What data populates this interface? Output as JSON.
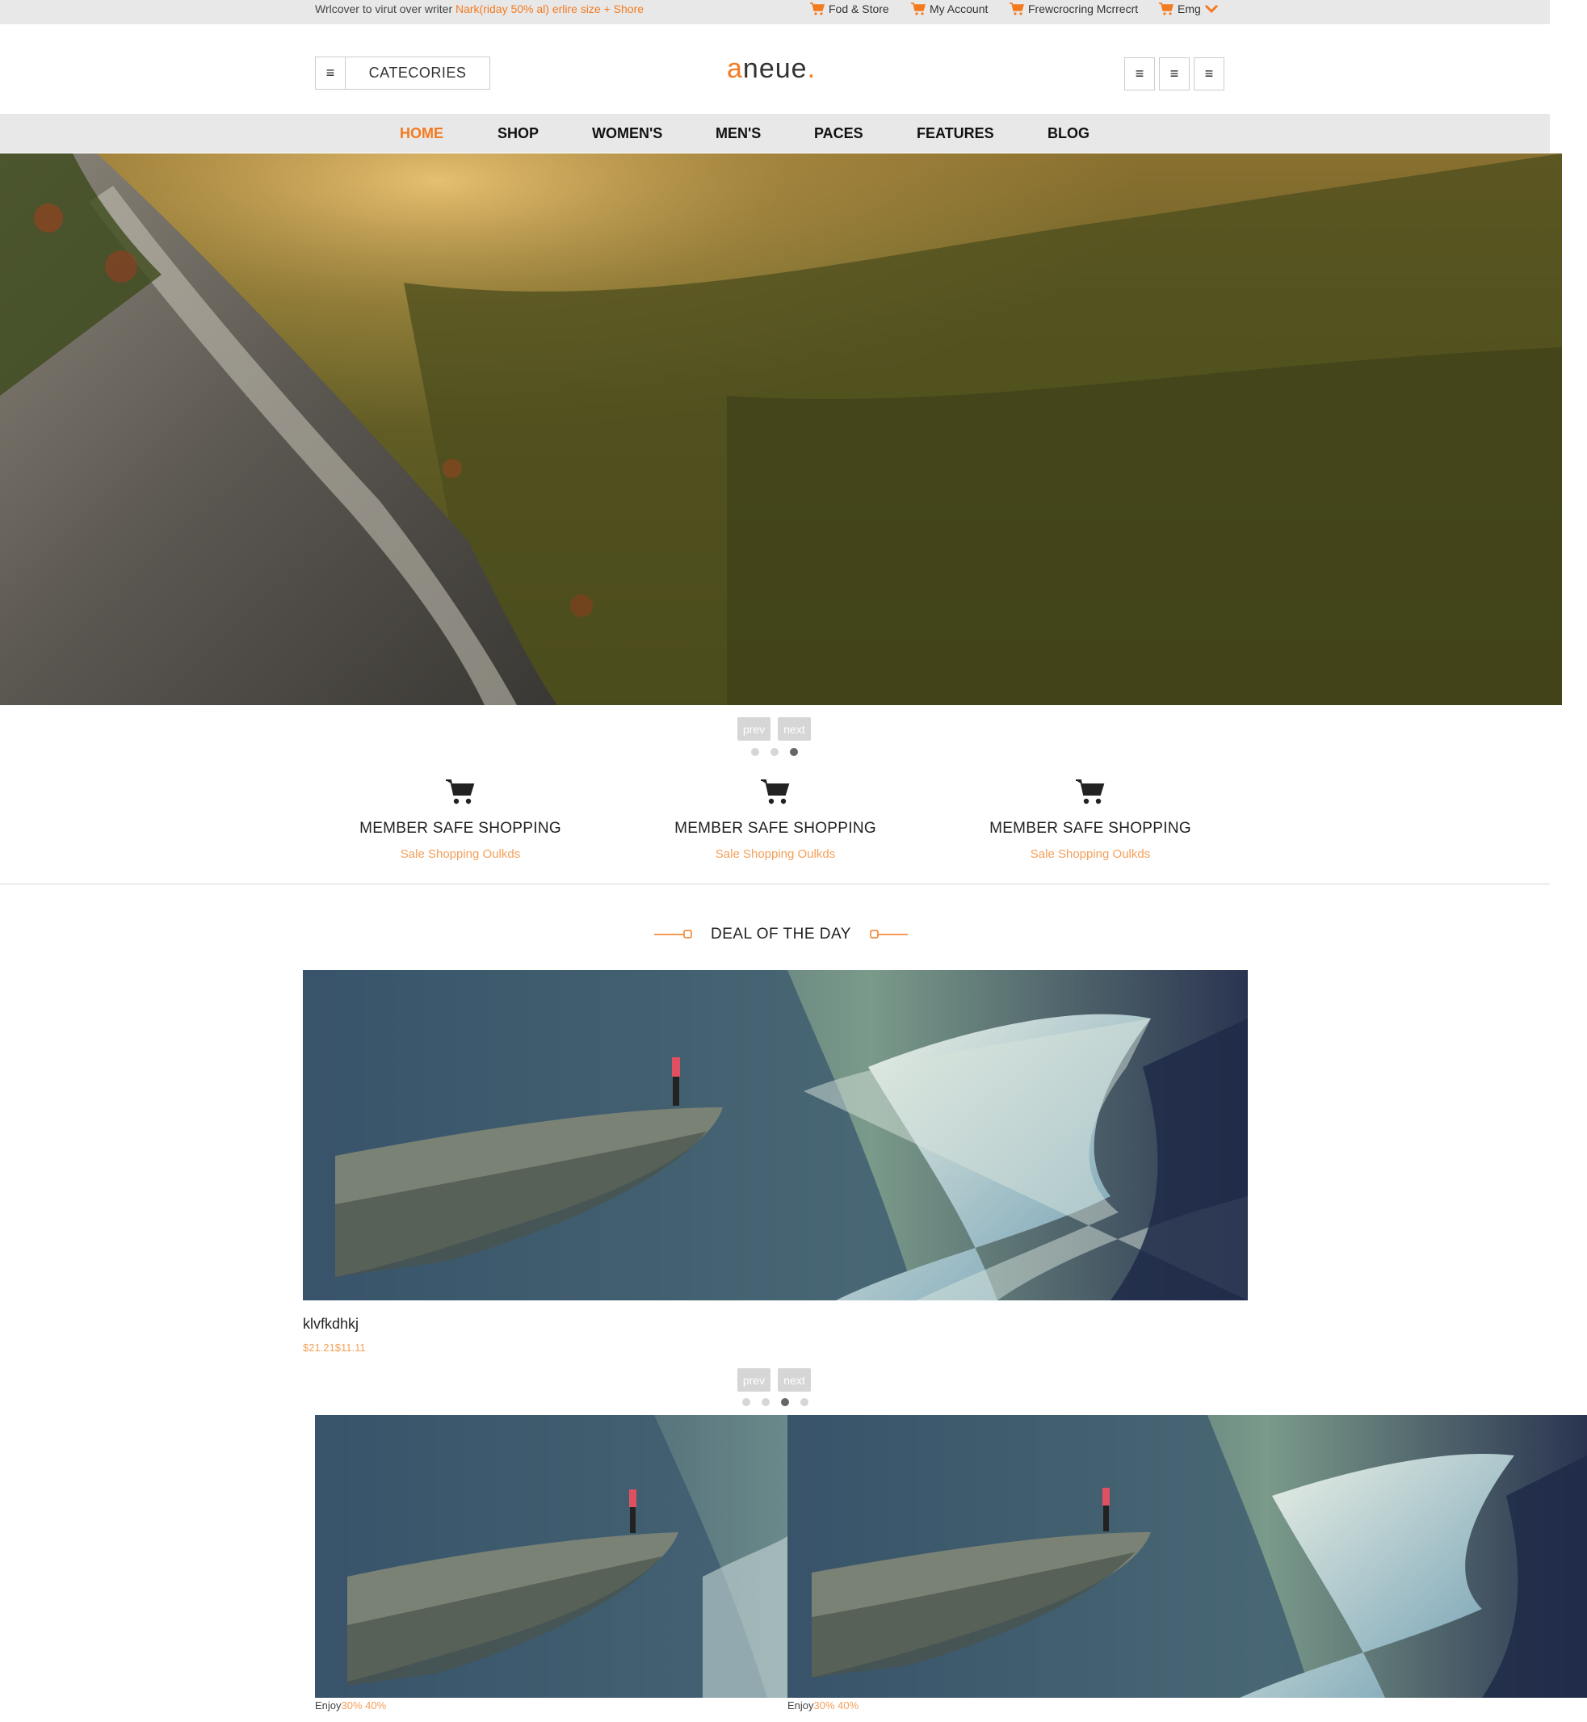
{
  "topbar": {
    "welcome_text": "Wrlcover to virut over writer ",
    "promo_text": "Nark(riday 50% al) erlire size + Shore",
    "links": [
      {
        "label": "Fod & Store",
        "icon": "cart-icon"
      },
      {
        "label": "My Account",
        "icon": "cart-icon"
      },
      {
        "label": "Frewcrocring Mcrrecrt",
        "icon": "cart-icon"
      },
      {
        "label": "Emg",
        "icon": "cart-icon"
      }
    ]
  },
  "header": {
    "categories_label": "CATECORIES",
    "menu_icon": "hamburger-icon",
    "logo_first": "a",
    "logo_rest": "neue",
    "logo_dot": "."
  },
  "nav": {
    "items": [
      "HOME",
      "SHOP",
      "WOMEN'S",
      "MEN'S",
      "PACES",
      "FEATURES",
      "BLOG"
    ],
    "active": "HOME"
  },
  "slider": {
    "prev_label": "prev",
    "next_label": "next",
    "active_index": 2,
    "count": 3
  },
  "features": [
    {
      "title": "MEMBER SAFE SHOPPING",
      "subtitle": "Sale Shopping Oulkds",
      "icon": "cart-icon"
    },
    {
      "title": "MEMBER SAFE SHOPPING",
      "subtitle": "Sale Shopping Oulkds",
      "icon": "cart-icon"
    },
    {
      "title": "MEMBER SAFE SHOPPING",
      "subtitle": "Sale Shopping Oulkds",
      "icon": "cart-icon"
    }
  ],
  "deal": {
    "title": "DEAL OF THE DAY",
    "product_name": "klvfkdhkj",
    "price": "$21.21$11.11",
    "prev_label": "prev",
    "next_label": "next",
    "active_index": 2,
    "count": 4
  },
  "thumbs": [
    {
      "caption": "Enjoy",
      "highlight": "30% 40%"
    },
    {
      "caption": "Enjoy",
      "highlight": "30% 40%"
    }
  ],
  "colors": {
    "accent": "#f47a20",
    "accent_light": "#f4a05a",
    "bar_bg": "#e8e8e8"
  }
}
